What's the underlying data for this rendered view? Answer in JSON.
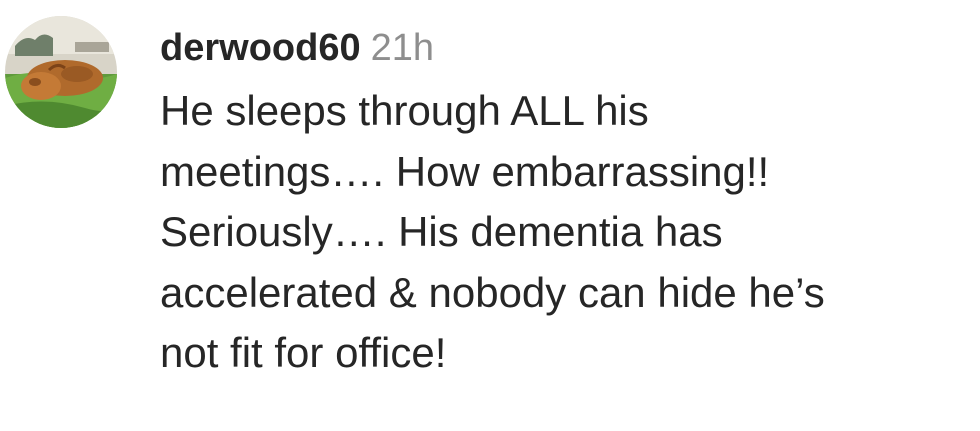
{
  "comment": {
    "username": "derwood60",
    "timestamp": "21h",
    "avatar_icon": "profile-photo-avatar",
    "text_lines": [
      "He sleeps through ALL his",
      "meetings…. How embarrassing!!",
      "Seriously…. His dementia has",
      "accelerated & nobody can hide he’s",
      "not fit for office!"
    ]
  },
  "colors": {
    "text": "#262626",
    "muted": "#8e8e8e",
    "background": "#ffffff"
  }
}
